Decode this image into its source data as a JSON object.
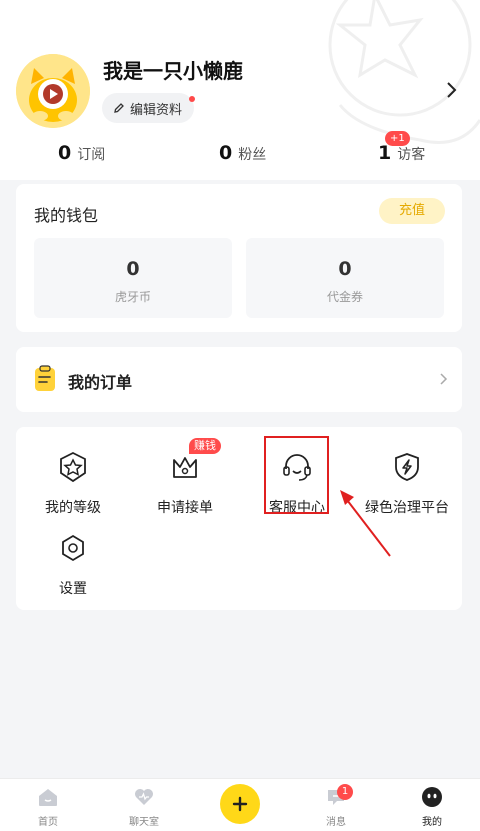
{
  "profile": {
    "username": "我是一只小懒鹿",
    "edit_label": "编辑资料",
    "stats": [
      {
        "value": "0",
        "label": "订阅"
      },
      {
        "value": "0",
        "label": "粉丝"
      },
      {
        "value": "1",
        "label": "访客"
      }
    ],
    "visitor_badge": "+1"
  },
  "wallet": {
    "title": "我的钱包",
    "recharge_label": "充值",
    "items": [
      {
        "value": "0",
        "label": "虎牙币"
      },
      {
        "value": "0",
        "label": "代金券"
      }
    ]
  },
  "orders": {
    "label": "我的订单"
  },
  "services": {
    "items": [
      {
        "label": "我的等级",
        "icon": "level-badge-icon"
      },
      {
        "label": "申请接单",
        "icon": "crown-icon",
        "badge": "赚钱"
      },
      {
        "label": "客服中心",
        "icon": "headset-icon"
      },
      {
        "label": "绿色治理平台",
        "icon": "shield-bolt-icon"
      },
      {
        "label": "设置",
        "icon": "gear-icon"
      }
    ]
  },
  "tabbar": {
    "items": [
      {
        "label": "首页",
        "icon": "home-icon"
      },
      {
        "label": "聊天室",
        "icon": "chat-heart-icon"
      },
      {
        "label": "",
        "icon": "plus-icon"
      },
      {
        "label": "消息",
        "icon": "message-icon",
        "badge": "1"
      },
      {
        "label": "我的",
        "icon": "profile-icon",
        "active": true
      }
    ]
  },
  "colors": {
    "accent_yellow": "#ffd818",
    "badge_red": "#ff4b4b",
    "annotation_red": "#e02020"
  }
}
